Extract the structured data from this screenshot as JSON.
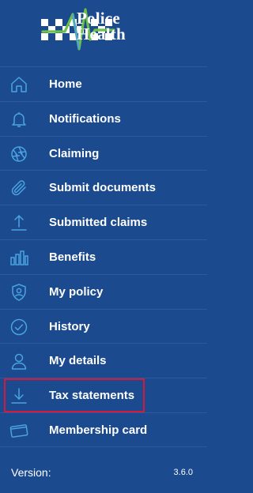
{
  "brand": {
    "line1": "Police",
    "line2": "Health"
  },
  "menu": {
    "items": [
      {
        "label": "Home",
        "icon": "home-icon"
      },
      {
        "label": "Notifications",
        "icon": "bell-icon"
      },
      {
        "label": "Claiming",
        "icon": "aperture-icon"
      },
      {
        "label": "Submit documents",
        "icon": "paperclip-icon"
      },
      {
        "label": "Submitted claims",
        "icon": "upload-icon"
      },
      {
        "label": "Benefits",
        "icon": "bar-chart-icon"
      },
      {
        "label": "My policy",
        "icon": "shield-user-icon"
      },
      {
        "label": "History",
        "icon": "check-circle-icon"
      },
      {
        "label": "My details",
        "icon": "user-icon"
      },
      {
        "label": "Tax statements",
        "icon": "download-icon"
      },
      {
        "label": "Membership card",
        "icon": "card-icon"
      }
    ],
    "selected": "Tax statements"
  },
  "footer": {
    "version_label": "Version:",
    "version_value": "3.6.0"
  },
  "colors": {
    "background": "#1b4a8e",
    "icon": "#4aa3e0",
    "highlight_border": "#d6183c",
    "logo_green": "#6cc04a"
  }
}
